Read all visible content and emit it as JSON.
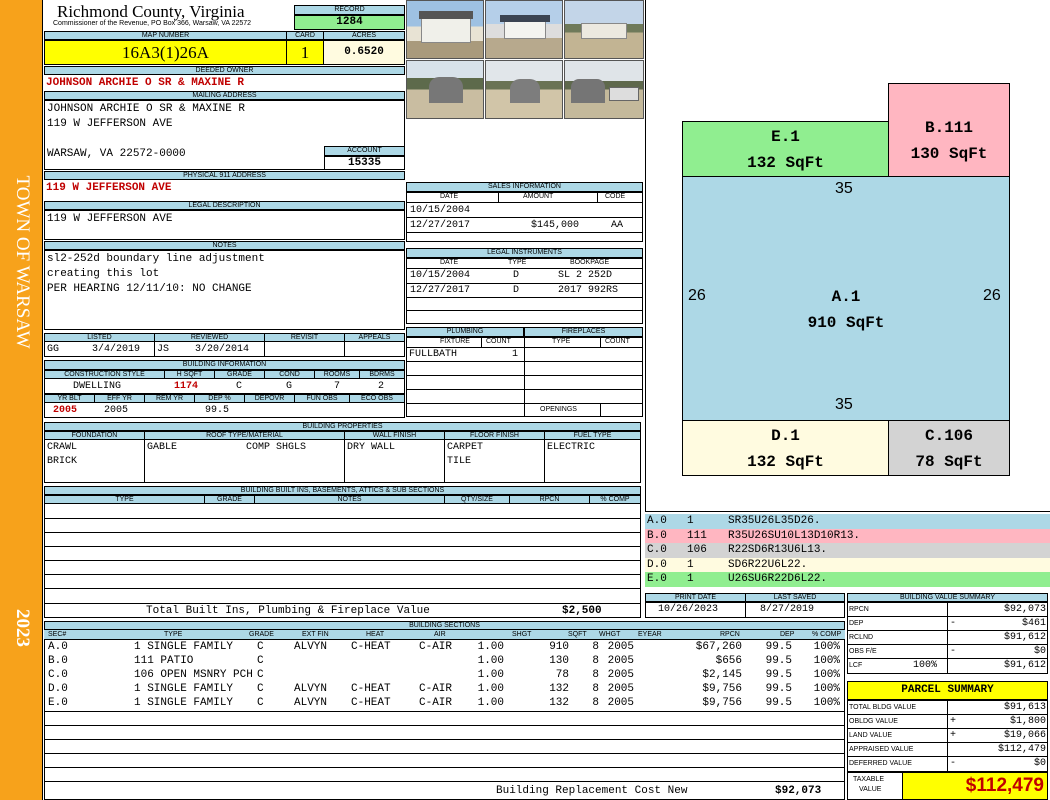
{
  "sidebar": {
    "town": "TOWN OF WARSAW",
    "year": "2023"
  },
  "header": {
    "county": "Richmond County, Virginia",
    "commissioner": "Commissioner of the Revenue, PO Box 366, Warsaw, VA 22572",
    "record_label": "RECORD",
    "record": "1284",
    "map_label": "MAP NUMBER",
    "map": "16A3(1)26A",
    "card_label": "CARD",
    "card": "1",
    "acres_label": "ACRES",
    "acres": "0.6520"
  },
  "owner": {
    "label": "DEEDED OWNER",
    "name": "JOHNSON ARCHIE O SR & MAXINE R"
  },
  "mailing": {
    "label": "MAILING ADDRESS",
    "line1": "JOHNSON ARCHIE O SR & MAXINE R",
    "line2": "119 W JEFFERSON AVE",
    "line3": "WARSAW, VA 22572-0000",
    "account_label": "ACCOUNT",
    "account": "15335"
  },
  "physical": {
    "label": "PHYSICAL 911 ADDRESS",
    "address": "119 W JEFFERSON AVE"
  },
  "legal": {
    "label": "LEGAL DESCRIPTION",
    "text": "119 W JEFFERSON AVE"
  },
  "notes": {
    "label": "NOTES",
    "line1": "sl2-252d boundary line adjustment",
    "line2": "creating this lot",
    "line3": "PER HEARING 12/11/10: NO CHANGE"
  },
  "sales": {
    "title": "SALES INFORMATION",
    "h_date": "DATE",
    "h_amount": "AMOUNT",
    "h_code": "CODE",
    "rows": [
      {
        "date": "10/15/2004",
        "amount": "",
        "code": ""
      },
      {
        "date": "12/27/2017",
        "amount": "$145,000",
        "code": "AA"
      }
    ]
  },
  "legal_instr": {
    "title": "LEGAL INSTRUMENTS",
    "h_date": "DATE",
    "h_type": "TYPE",
    "h_book": "BOOKPAGE",
    "rows": [
      {
        "date": "10/15/2004",
        "type": "D",
        "book": "SL 2 252D"
      },
      {
        "date": "12/27/2017",
        "type": "D",
        "book": "2017 992RS"
      }
    ]
  },
  "listing": {
    "h_listed": "LISTED",
    "h_reviewed": "REVIEWED",
    "h_revisit": "REVISIT",
    "h_appeals": "APPEALS",
    "listed_by": "GG",
    "listed": "3/4/2019",
    "reviewed_by": "JS",
    "reviewed": "3/20/2014"
  },
  "plumbing": {
    "title": "PLUMBING",
    "h_fixture": "FIXTURE",
    "h_count": "COUNT",
    "fixture": "FULLBATH",
    "count": "1"
  },
  "fireplaces": {
    "title": "FIREPLACES",
    "h_type": "TYPE",
    "h_count": "COUNT",
    "openings": "OPENINGS"
  },
  "building_info": {
    "title": "BUILDING INFORMATION",
    "h_style": "CONSTRUCTION STYLE",
    "h_hsqft": "H SQFT",
    "h_grade": "GRADE",
    "h_cond": "COND",
    "h_rooms": "ROOMS",
    "h_bdrms": "BDRMS",
    "style": "DWELLING",
    "hsqft": "1174",
    "grade": "C",
    "cond": "G",
    "rooms": "7",
    "bdrms": "2",
    "h_yrblt": "YR BLT",
    "h_effyr": "EFF YR",
    "h_remyr": "REM YR",
    "h_dep": "DEP %",
    "h_depovr": "DEPOVR",
    "h_funobs": "FUN OBS",
    "h_ecoobs": "ECO OBS",
    "yrblt": "2005",
    "effyr": "2005",
    "dep": "99.5"
  },
  "properties": {
    "title": "BUILDING PROPERTIES",
    "h_found": "FOUNDATION",
    "h_roof": "ROOF TYPE/MATERIAL",
    "h_wall": "WALL FINISH",
    "h_floor": "FLOOR FINISH",
    "h_fuel": "FUEL TYPE",
    "found1": "CRAWL",
    "found2": "BRICK",
    "roof1": "GABLE",
    "roof2": "COMP SHGLS",
    "wall": "DRY WALL",
    "floor1": "CARPET",
    "floor2": "TILE",
    "fuel": "ELECTRIC"
  },
  "builtins": {
    "title": "BUILDING BUILT INS, BASEMENTS, ATTICS & SUB SECTIONS",
    "h_type": "TYPE",
    "h_grade": "GRADE",
    "h_notes": "NOTES",
    "h_qty": "QTY/SIZE",
    "h_rpcn": "RPCN",
    "h_comp": "% COMP",
    "total_label": "Total Built Ins, Plumbing & Fireplace Value",
    "total": "$2,500"
  },
  "sketch": {
    "e": {
      "label": "E.1",
      "area": "132 SqFt"
    },
    "b": {
      "label": "B.111",
      "area": "130 SqFt"
    },
    "a": {
      "label": "A.1",
      "area": "910 SqFt"
    },
    "d": {
      "label": "D.1",
      "area": "132 SqFt"
    },
    "c": {
      "label": "C.106",
      "area": "78 SqFt"
    },
    "dim_top": "35",
    "dim_bottom": "35",
    "dim_left": "26",
    "dim_right": "26"
  },
  "sketch_legend": [
    {
      "sec": "A.0",
      "code": "1",
      "path": "SR35U26L35D26.",
      "color": "#add8e6"
    },
    {
      "sec": "B.0",
      "code": "111",
      "path": "R35U26SU10L13D10R13.",
      "color": "#ffb6c1"
    },
    {
      "sec": "C.0",
      "code": "106",
      "path": "R22SD6R13U6L13.",
      "color": "#d3d3d3"
    },
    {
      "sec": "D.0",
      "code": "1",
      "path": "SD6R22U6L22.",
      "color": "#fffbe0"
    },
    {
      "sec": "E.0",
      "code": "1",
      "path": "U26SU6R22D6L22.",
      "color": "#90ee90"
    }
  ],
  "dates": {
    "h_print": "PRINT DATE",
    "h_saved": "LAST SAVED",
    "print": "10/26/2023",
    "saved": "8/27/2019"
  },
  "sections": {
    "title": "BUILDING SECTIONS",
    "headers": [
      "SEC#",
      "TYPE",
      "GRADE",
      "EXT FIN",
      "HEAT",
      "AIR",
      "SHGT",
      "SQFT",
      "WHGT",
      "EYEAR",
      "RPCN",
      "DEP",
      "% COMP"
    ],
    "rows": [
      [
        "A.0",
        "1 SINGLE FAMILY",
        "C",
        "ALVYN",
        "C-HEAT",
        "C-AIR",
        "1.00",
        "910",
        "8",
        "2005",
        "$67,260",
        "99.5",
        "100%"
      ],
      [
        "B.0",
        "111 PATIO",
        "C",
        "",
        "",
        "",
        "1.00",
        "130",
        "8",
        "2005",
        "$656",
        "99.5",
        "100%"
      ],
      [
        "C.0",
        "106 OPEN MSNRY PCH",
        "C",
        "",
        "",
        "",
        "1.00",
        "78",
        "8",
        "2005",
        "$2,145",
        "99.5",
        "100%"
      ],
      [
        "D.0",
        "1 SINGLE FAMILY",
        "C",
        "ALVYN",
        "C-HEAT",
        "C-AIR",
        "1.00",
        "132",
        "8",
        "2005",
        "$9,756",
        "99.5",
        "100%"
      ],
      [
        "E.0",
        "1 SINGLE FAMILY",
        "C",
        "ALVYN",
        "C-HEAT",
        "C-AIR",
        "1.00",
        "132",
        "8",
        "2005",
        "$9,756",
        "99.5",
        "100%"
      ]
    ],
    "replacement_label": "Building Replacement Cost New",
    "replacement": "$92,073"
  },
  "bvs": {
    "title": "BUILDING VALUE SUMMARY",
    "rpcn_label": "RPCN",
    "rpcn": "$92,073",
    "dep_label": "DEP",
    "dep_sign": "-",
    "dep": "$461",
    "rclnd_label": "RCLND",
    "rclnd": "$91,612",
    "obs_label": "OBS F/E",
    "obs_sign": "-",
    "obs": "$0",
    "lcf_label": "LCF",
    "lcf_pct": "100%",
    "lcf": "$91,612"
  },
  "parcel": {
    "title": "PARCEL SUMMARY",
    "tbv_label": "TOTAL BLDG VALUE",
    "tbv": "$91,613",
    "obldg_label": "OBLDG VALUE",
    "obldg_sign": "+",
    "obldg": "$1,800",
    "land_label": "LAND VALUE",
    "land_sign": "+",
    "land": "$19,066",
    "appraised_label": "APPRAISED VALUE",
    "appraised": "$112,479",
    "deferred_label": "DEFERRED VALUE",
    "deferred_sign": "-",
    "deferred": "$0",
    "taxable_label1": "TAXABLE",
    "taxable_label2": "VALUE",
    "taxable": "$112,479"
  }
}
